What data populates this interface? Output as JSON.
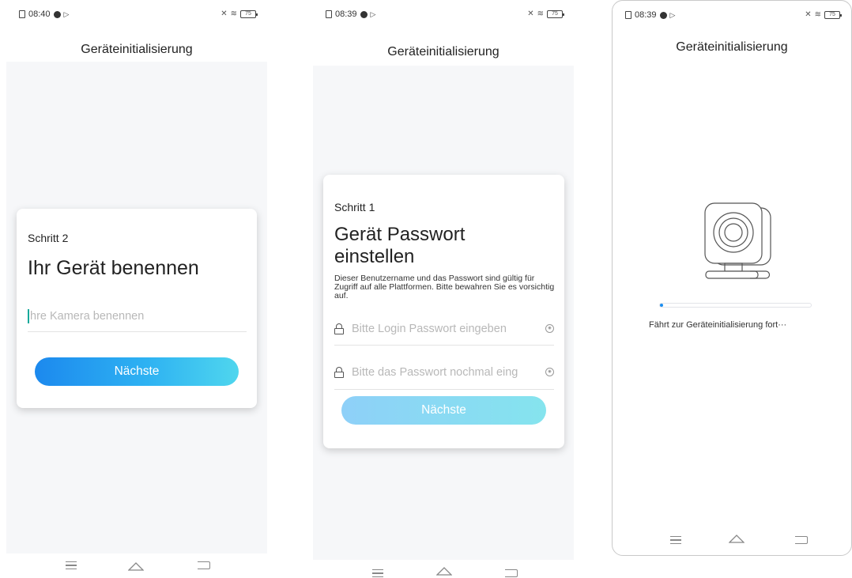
{
  "screen1": {
    "status": {
      "time": "08:40",
      "battery": "75"
    },
    "title": "Geräteinitialisierung",
    "step": "Schritt 2",
    "heading": "Ihr Gerät benennen",
    "name_input": {
      "placeholder": "hre Kamera benennen"
    },
    "next_button": "Nächste"
  },
  "screen2": {
    "status": {
      "time": "08:39",
      "battery": "75"
    },
    "title": "Geräteinitialisierung",
    "step": "Schritt 1",
    "heading": "Gerät Passwort einstellen",
    "description": "Dieser Benutzername und das Passwort sind gültig für Zugriff auf alle Plattformen. Bitte bewahren Sie es vorsichtig auf.",
    "password_input": {
      "placeholder": "Bitte Login Passwort eingeben"
    },
    "confirm_input": {
      "placeholder": "Bitte das Passwort nochmal eing"
    },
    "next_button": "Nächste",
    "next_button_enabled": false
  },
  "screen3": {
    "status": {
      "time": "08:39",
      "battery": "75"
    },
    "title": "Geräteinitialisierung",
    "progress_percent": 2,
    "progress_text": "Fährt zur Geräteinitialisierung fort···"
  },
  "icons": {
    "status_left": [
      "sim-icon",
      "location-icon",
      "play-icon"
    ],
    "status_right": [
      "mute-icon",
      "wifi-icon",
      "battery-icon"
    ],
    "fields": [
      "lock-icon",
      "eye-icon"
    ],
    "navigation": [
      "menu-icon",
      "home-icon",
      "back-icon"
    ],
    "illustration": "camera-icon"
  },
  "colors": {
    "accent": "#1a8df0",
    "button_gradient_start": "#1c89ee",
    "button_gradient_end": "#4fd6ee",
    "button_disabled_start": "#8ed0f8",
    "button_disabled_end": "#85e4ee",
    "background": "#f6f7f9",
    "cursor": "#17a99b"
  }
}
